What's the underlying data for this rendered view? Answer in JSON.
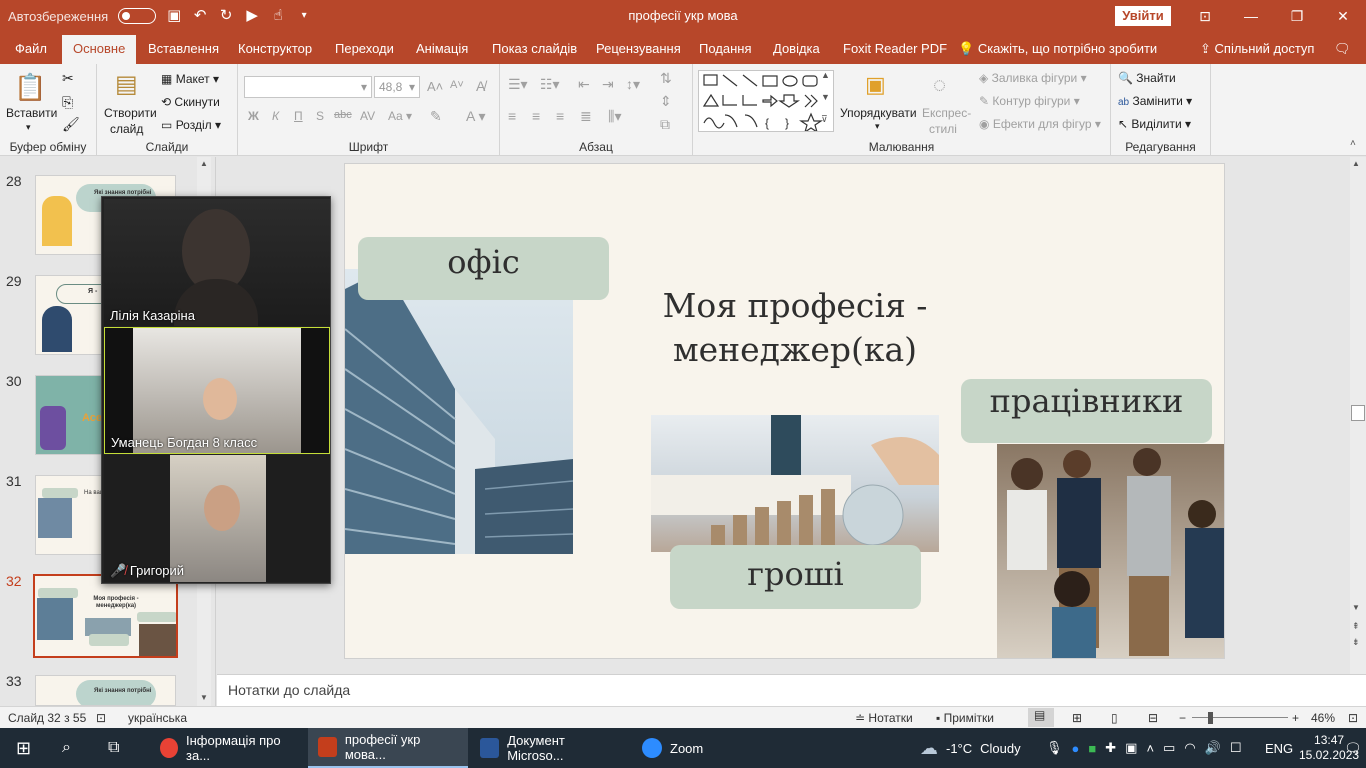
{
  "titlebar": {
    "autosave_label": "Автозбереження",
    "doc_title": "професії укр мова",
    "signin_label": "Увійти"
  },
  "tabs": {
    "file": "Файл",
    "home": "Основне",
    "insert": "Вставлення",
    "design": "Конструктор",
    "transitions": "Переходи",
    "animations": "Анімація",
    "slideshow": "Показ слайдів",
    "review": "Рецензування",
    "view": "Подання",
    "help": "Довідка",
    "foxit": "Foxit Reader PDF",
    "tellme": "Скажіть, що потрібно зробити",
    "share": "Спільний доступ"
  },
  "ribbon": {
    "clipboard": {
      "paste": "Вставити",
      "label": "Буфер обміну"
    },
    "slides": {
      "new_slide": "Створити",
      "new_slide2": "слайд",
      "layout": "Макет",
      "reset": "Скинути",
      "section": "Розділ",
      "label": "Слайди"
    },
    "font": {
      "size": "48,8",
      "bold": "Ж",
      "italic": "К",
      "underline": "П",
      "shadow": "S",
      "strike": "abc",
      "case": "Aa",
      "label": "Шрифт"
    },
    "paragraph": {
      "label": "Абзац"
    },
    "drawing": {
      "arrange": "Упорядкувати",
      "quick_styles1": "Експрес-",
      "quick_styles2": "стилі",
      "fill": "Заливка фігури",
      "outline": "Контур фігури",
      "effects": "Ефекти для фігур",
      "label": "Малювання"
    },
    "editing": {
      "find": "Знайти",
      "replace": "Замінити",
      "select": "Виділити",
      "label": "Редагування"
    }
  },
  "thumbnails": [
    {
      "num": "28",
      "title": "Які знання потрібні"
    },
    {
      "num": "29",
      "title": "Я -"
    },
    {
      "num": "30",
      "title": "Асе"
    },
    {
      "num": "31",
      "title": "На вашу думку"
    },
    {
      "num": "32",
      "title": "Моя професія - менеджер(ка)"
    },
    {
      "num": "33",
      "title": "Які знання потрібні"
    }
  ],
  "slide": {
    "title_line1": "Моя професія -",
    "title_line2": "менеджер(ка)",
    "office": "офіс",
    "money": "гроші",
    "workers": "працівники"
  },
  "zoom": {
    "participants": [
      {
        "name": "Лілія Казаріна",
        "muted": false
      },
      {
        "name": "Уманець Богдан 8 класс",
        "muted": false
      },
      {
        "name": "Григорий",
        "muted": true
      }
    ]
  },
  "notes": {
    "placeholder": "Нотатки до слайда"
  },
  "statusbar": {
    "slide_count": "Слайд 32 з 55",
    "language": "українська",
    "notes": "Нотатки",
    "comments": "Примітки",
    "zoom": "46%"
  },
  "taskbar": {
    "apps": [
      {
        "label": "Інформація про за...",
        "color": "#e94235"
      },
      {
        "label": "професії укр мова...",
        "color": "#c43e1c"
      },
      {
        "label": "Документ Microso...",
        "color": "#2b579a"
      },
      {
        "label": "Zoom",
        "color": "#2d8cff"
      }
    ],
    "weather_temp": "-1°C",
    "weather_text": "Cloudy",
    "lang": "ENG",
    "time": "13:47",
    "date": "15.02.2023"
  }
}
